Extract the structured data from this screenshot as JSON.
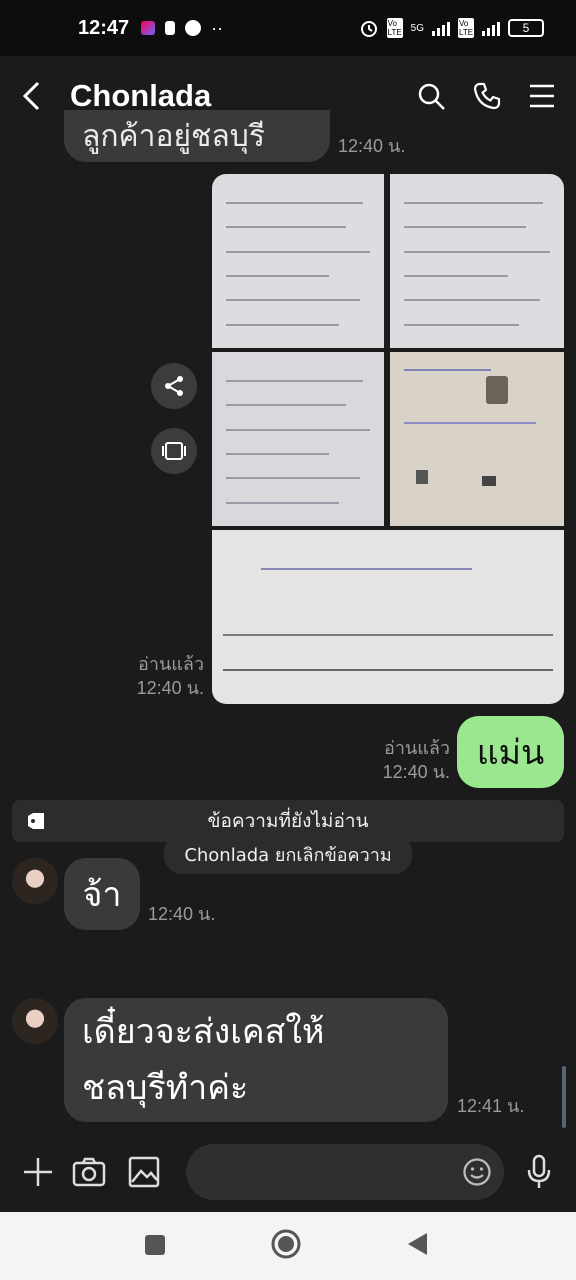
{
  "status": {
    "time": "12:47",
    "battery": "5",
    "network1": "Vo LTE",
    "network2": "5G",
    "network3": "Vo LTE"
  },
  "header": {
    "title": "Chonlada"
  },
  "messages": {
    "top_partial": {
      "text": "ลูกค้าอยู่ชลบุรี",
      "time": "12:40 น."
    },
    "photos": {
      "read_label": "อ่านแล้ว",
      "time": "12:40 น.",
      "count": 5
    },
    "out_text": {
      "text": "แม่น",
      "read_label": "อ่านแล้ว",
      "time": "12:40 น."
    },
    "unread_divider": "ข้อความที่ยังไม่อ่าน",
    "reply1": {
      "text": "จ้า",
      "time": "12:40 น."
    },
    "system_note": "Chonlada ยกเลิกข้อความ",
    "reply2": {
      "line1": "เดี๋ยวจะส่งเคสให้",
      "line2": "ชลบุรีทำค่ะ",
      "time": "12:41 น."
    }
  },
  "colors": {
    "bg": "#1b1b1b",
    "bubble_in": "#3a3a3a",
    "bubble_out": "#9ae790"
  }
}
